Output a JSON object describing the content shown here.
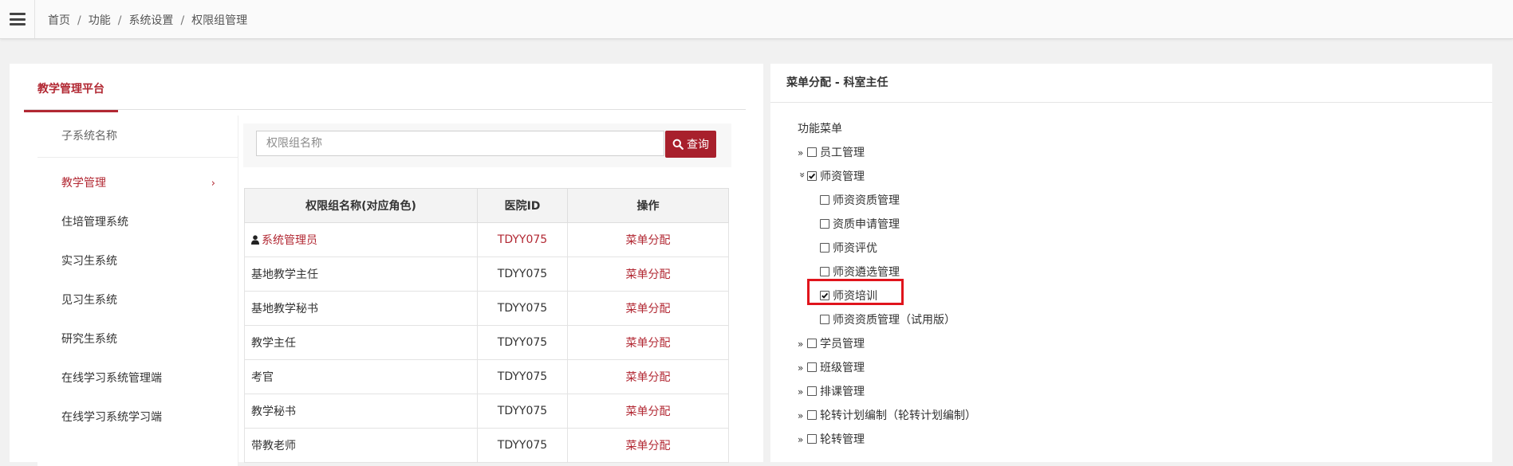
{
  "breadcrumb": {
    "items": [
      "首页",
      "功能",
      "系统设置",
      "权限组管理"
    ],
    "separator": "/"
  },
  "left_tab": {
    "label": "教学管理平台"
  },
  "subsystems": {
    "header": "子系统名称",
    "items": [
      {
        "label": "教学管理",
        "active": true,
        "chevron": "›"
      },
      {
        "label": "住培管理系统"
      },
      {
        "label": "实习生系统"
      },
      {
        "label": "见习生系统"
      },
      {
        "label": "研究生系统"
      },
      {
        "label": "在线学习系统管理端"
      },
      {
        "label": "在线学习系统学习端"
      }
    ]
  },
  "search": {
    "placeholder": "权限组名称",
    "button_label": "查询",
    "button_icon": "search-icon"
  },
  "table": {
    "headers": [
      "权限组名称(对应角色)",
      "医院ID",
      "操作"
    ],
    "rows": [
      {
        "name": "系统管理员",
        "hospital_id": "TDYY075",
        "action": "菜单分配",
        "icon": "user-icon",
        "highlight": true
      },
      {
        "name": "基地教学主任",
        "hospital_id": "TDYY075",
        "action": "菜单分配"
      },
      {
        "name": "基地教学秘书",
        "hospital_id": "TDYY075",
        "action": "菜单分配"
      },
      {
        "name": "教学主任",
        "hospital_id": "TDYY075",
        "action": "菜单分配"
      },
      {
        "name": "考官",
        "hospital_id": "TDYY075",
        "action": "菜单分配"
      },
      {
        "name": "教学秘书",
        "hospital_id": "TDYY075",
        "action": "菜单分配"
      },
      {
        "name": "带教老师",
        "hospital_id": "TDYY075",
        "action": "菜单分配"
      }
    ]
  },
  "right_panel": {
    "title": "菜单分配 - 科室主任",
    "root_label": "功能菜单",
    "tree": [
      {
        "label": "员工管理",
        "level": 1,
        "expanded": false,
        "checked": false
      },
      {
        "label": "师资管理",
        "level": 1,
        "expanded": true,
        "checked": true
      },
      {
        "label": "师资资质管理",
        "level": 2,
        "checked": false
      },
      {
        "label": "资质申请管理",
        "level": 2,
        "checked": false
      },
      {
        "label": "师资评优",
        "level": 2,
        "checked": false
      },
      {
        "label": "师资遴选管理",
        "level": 2,
        "checked": false
      },
      {
        "label": "师资培训",
        "level": 2,
        "checked": true,
        "highlighted": true
      },
      {
        "label": "师资资质管理（试用版）",
        "level": 2,
        "checked": false
      },
      {
        "label": "学员管理",
        "level": 1,
        "expanded": false,
        "checked": false
      },
      {
        "label": "班级管理",
        "level": 1,
        "expanded": false,
        "checked": false
      },
      {
        "label": "排课管理",
        "level": 1,
        "expanded": false,
        "checked": false
      },
      {
        "label": "轮转计划编制（轮转计划编制）",
        "level": 1,
        "expanded": false,
        "checked": false
      },
      {
        "label": "轮转管理",
        "level": 1,
        "expanded": false,
        "checked": false
      }
    ]
  },
  "colors": {
    "accent": "#b22833",
    "button": "#a8202c",
    "highlight_box": "#e0141c"
  }
}
